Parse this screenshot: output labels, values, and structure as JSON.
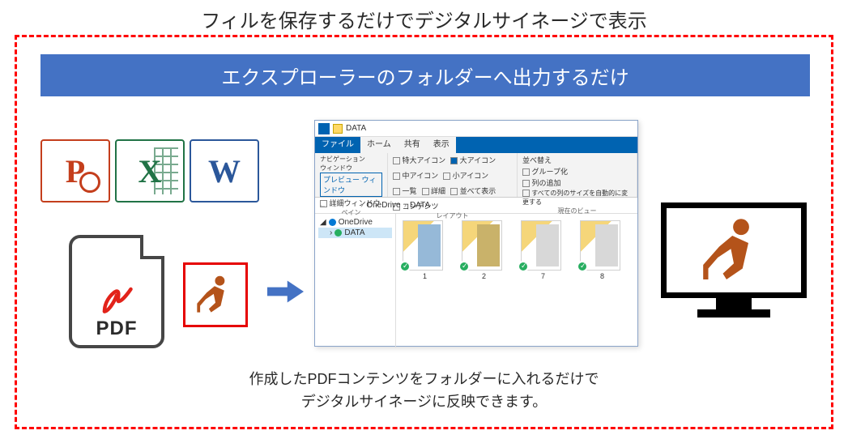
{
  "title": "フィルを保存するだけでデジタルサイネージで表示",
  "banner": "エクスプローラーのフォルダーへ出力するだけ",
  "office": {
    "ppt": "P",
    "xls": "X",
    "doc": "W"
  },
  "pdf_label": "PDF",
  "desc_line1": "作成したPDFコンテンツをフォルダーに入れるだけで",
  "desc_line2": "デジタルサイネージに反映できます。",
  "explorer": {
    "title": "DATA",
    "menu": {
      "file": "ファイル",
      "home": "ホーム",
      "share": "共有",
      "view": "表示"
    },
    "ribbon": {
      "nav_label": "ナビゲーション\nウィンドウ",
      "preview": "プレビュー ウィンドウ",
      "detail": "詳細ウィンドウ",
      "g1_label": "ペイン",
      "xl_icon": "特大アイコン",
      "l_icon": "大アイコン",
      "m_icon": "中アイコン",
      "s_icon": "小アイコン",
      "list": "一覧",
      "detail2": "詳細",
      "tiles": "並べて表示",
      "content": "コンテンツ",
      "g2_label": "レイアウト",
      "sort": "並べ替え",
      "group": "グループ化",
      "addcol": "列の追加",
      "autosize": "すべての列のサイズを自動的に変更する",
      "g3_label": "現在のビュー"
    },
    "path": {
      "up": "↑",
      "seg1": "OneDrive",
      "seg2": "DATA"
    },
    "tree": {
      "root": "OneDrive",
      "child": "DATA"
    },
    "files": [
      {
        "n": "1"
      },
      {
        "n": "2"
      },
      {
        "n": "7"
      },
      {
        "n": "8"
      }
    ]
  }
}
